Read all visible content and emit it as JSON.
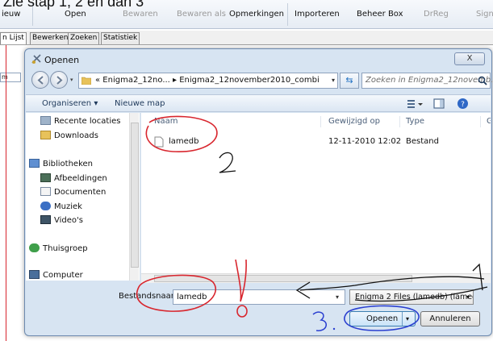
{
  "caption": "Zie stap 1, 2 en dan 3",
  "app": {
    "toolbar": [
      {
        "label": "ieuw",
        "dim": false
      },
      {
        "label": "Open",
        "dim": false
      },
      {
        "label": "Bewaren",
        "dim": true
      },
      {
        "label": "Bewaren als",
        "dim": true
      },
      {
        "label": "Opmerkingen",
        "dim": false
      },
      {
        "label": "Importeren",
        "dim": false
      },
      {
        "label": "Beheer Box",
        "dim": false
      },
      {
        "label": "DrReg",
        "dim": true
      },
      {
        "label": "Sign",
        "dim": true
      }
    ],
    "tabs": [
      "n Lijst",
      "Bewerken",
      "Zoeken",
      "Statistiek"
    ],
    "side_input": "m"
  },
  "dialog": {
    "title": "Openen",
    "close_label": "X",
    "address": "« Enigma2_12no... ▸ Enigma2_12november2010_combi",
    "search_placeholder": "Zoeken in Enigma2_12novemb...",
    "command_bar": {
      "organize": "Organiseren ▾",
      "new_folder": "Nieuwe map"
    },
    "nav_items": [
      {
        "label": "Recente locaties",
        "icon": "recent-locations-icon"
      },
      {
        "label": "Downloads",
        "icon": "downloads-folder-icon"
      },
      {
        "label": "Bibliotheken",
        "icon": "libraries-icon"
      },
      {
        "label": "Afbeeldingen",
        "icon": "pictures-icon"
      },
      {
        "label": "Documenten",
        "icon": "documents-icon"
      },
      {
        "label": "Muziek",
        "icon": "music-icon"
      },
      {
        "label": "Video's",
        "icon": "videos-icon"
      },
      {
        "label": "Thuisgroep",
        "icon": "homegroup-icon"
      },
      {
        "label": "Computer",
        "icon": "computer-icon"
      }
    ],
    "columns": {
      "name": "Naam",
      "modified": "Gewijzigd op",
      "type": "Type",
      "extra": "G"
    },
    "files": [
      {
        "name": "lamedb",
        "modified": "12-11-2010 12:02",
        "type": "Bestand"
      }
    ],
    "filename_label": "Bestandsnaam:",
    "filename_value": "lamedb",
    "filter": "Enigma 2 Files (lamedb) (lamec",
    "open_label": "Openen",
    "cancel_label": "Annuleren"
  },
  "annotations": {
    "color_red": "#d8262e",
    "color_blue": "#2a3fd0",
    "color_black": "#111111",
    "labels": [
      "1",
      "2",
      "3",
      "!",
      "0"
    ]
  }
}
